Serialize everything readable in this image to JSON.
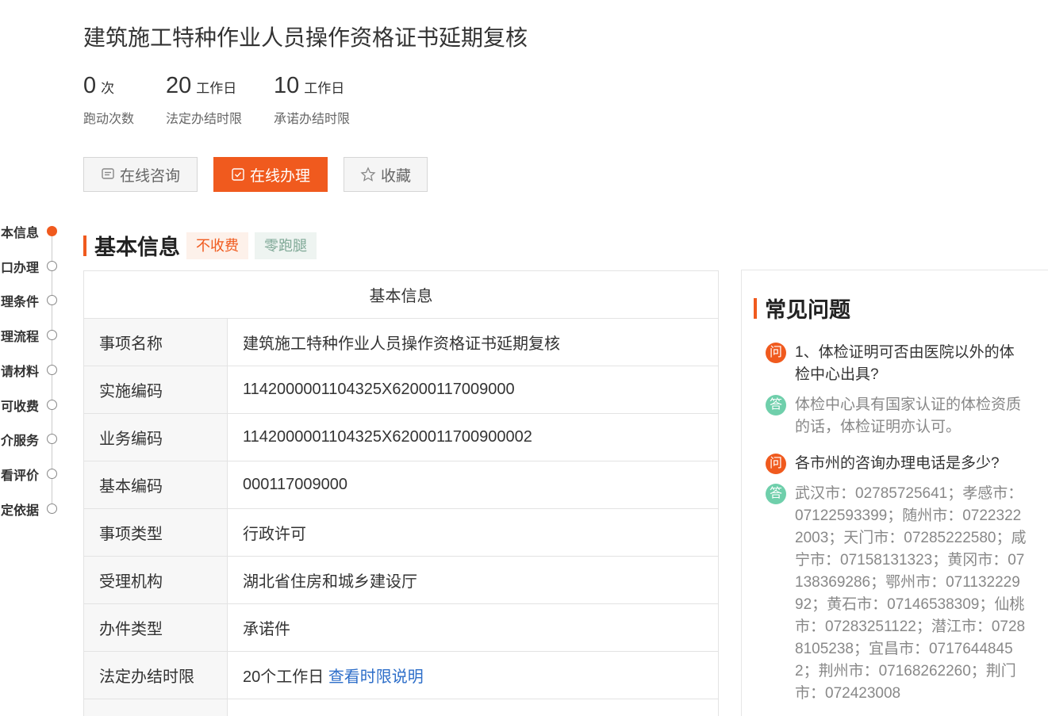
{
  "page": {
    "title": "建筑施工特种作业人员操作资格证书延期复核"
  },
  "stats": [
    {
      "value": "0",
      "unit": "次",
      "label": "跑动次数"
    },
    {
      "value": "20",
      "unit": "工作日",
      "label": "法定办结时限"
    },
    {
      "value": "10",
      "unit": "工作日",
      "label": "承诺办结时限"
    }
  ],
  "actions": {
    "consult_label": "在线咨询",
    "handle_label": "在线办理",
    "favorite_label": "收藏"
  },
  "side_nav": {
    "items": [
      {
        "label": "本信息",
        "active": true
      },
      {
        "label": "口办理",
        "active": false
      },
      {
        "label": "理条件",
        "active": false
      },
      {
        "label": "理流程",
        "active": false
      },
      {
        "label": "请材料",
        "active": false
      },
      {
        "label": "可收费",
        "active": false
      },
      {
        "label": "介服务",
        "active": false
      },
      {
        "label": "看评价",
        "active": false
      },
      {
        "label": "定依据",
        "active": false
      }
    ]
  },
  "basic_info": {
    "section_title": "基本信息",
    "tag_fee": "不收费",
    "tag_zero": "零跑腿",
    "table_header": "基本信息",
    "rows": [
      {
        "key": "事项名称",
        "value": "建筑施工特种作业人员操作资格证书延期复核"
      },
      {
        "key": "实施编码",
        "value": "1142000001104325X62000117009000"
      },
      {
        "key": "业务编码",
        "value": "1142000001104325X6200011700900002"
      },
      {
        "key": "基本编码",
        "value": "000117009000"
      },
      {
        "key": "事项类型",
        "value": "行政许可"
      },
      {
        "key": "受理机构",
        "value": "湖北省住房和城乡建设厅"
      },
      {
        "key": "办件类型",
        "value": "承诺件"
      },
      {
        "key": "法定办结时限",
        "value": "20个工作日",
        "link": "查看时限说明"
      }
    ]
  },
  "faq": {
    "title": "常见问题",
    "q_badge": "问",
    "a_badge": "答",
    "items": [
      {
        "question": "1、体检证明可否由医院以外的体检中心出具?",
        "answer": "体检中心具有国家认证的体检资质的话，体检证明亦认可。"
      },
      {
        "question": "各市州的咨询办理电话是多少?",
        "answer": "武汉市：02785725641；孝感市：07122593399；随州市：07223222003；天门市：07285222580；咸宁市：07158131323；黄冈市：07138369286；鄂州市：07113222992；黄石市：07146538309；仙桃市：07283251122；潜江市：07288105238；宜昌市：07176448452；荆州市：07168262260；荆门市：072423008"
      }
    ]
  },
  "colors": {
    "accent": "#f05a1e",
    "answer_badge": "#6fcfab",
    "link": "#2d6ec9"
  }
}
